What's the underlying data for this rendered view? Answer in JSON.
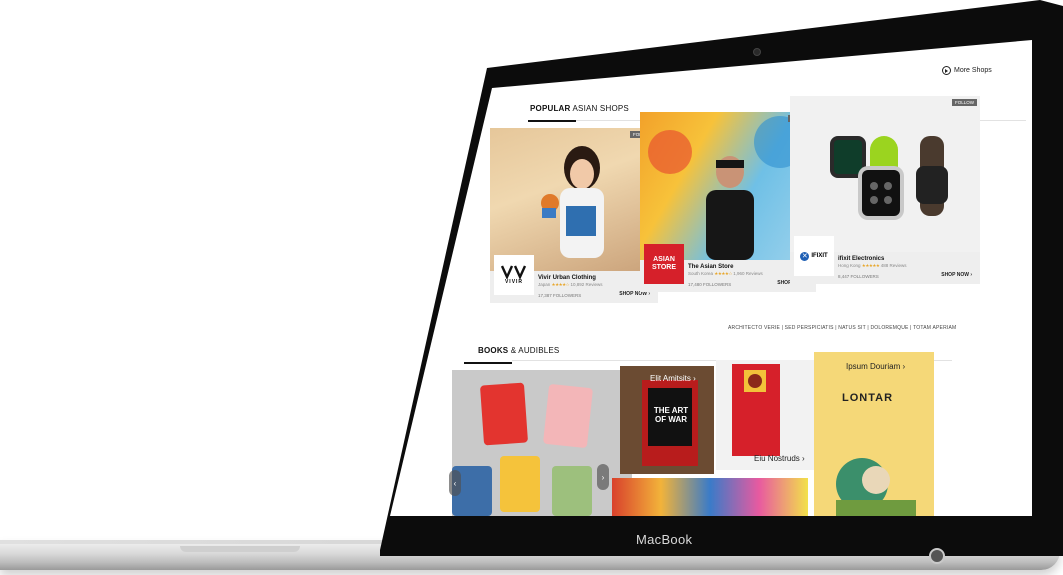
{
  "device": {
    "brand": "MacBook"
  },
  "header": {
    "more_shops": "More Shops"
  },
  "popular": {
    "title_bold": "POPULAR",
    "title_rest": " ASIAN SHOPS",
    "shops": [
      {
        "name": "Vivir Urban Clothing",
        "location": "Japan",
        "stars": "★★★★☆",
        "reviews": "10,892 Reviews",
        "followers": "17,387 FOLLOWERS",
        "cta": "SHOP NOW",
        "follow": "FOLLOW",
        "logo_text": "VIVIR"
      },
      {
        "name": "The Asian Store",
        "location": "South Korea",
        "stars": "★★★★☆",
        "reviews": "1,960 Reviews",
        "followers": "17,480 FOLLOWERS",
        "cta": "SHOP NOW",
        "follow": "FOLLOW",
        "logo_text": "ASIAN STORE"
      },
      {
        "name": "ifixit Electronics",
        "location": "Hong Kong",
        "stars": "★★★★★",
        "reviews": "488 Reviews",
        "followers": "8,447 FOLLOWERS",
        "cta": "SHOP NOW",
        "follow": "FOLLOW",
        "logo_text": "IFIXIT"
      }
    ]
  },
  "books": {
    "title_bold": "BOOKS",
    "title_rest": " & AUDIBLES",
    "categories": "ARCHITECTO VERIE  |  SED PERSPICIATIS  |  NATUS SIT  |  DOLOREMQUE  |  TOTAM APERIAM",
    "items": [
      {
        "title": "Elit Amitsits ›"
      },
      {
        "title": "Eiu Nostruds ›"
      },
      {
        "title": "Ipsum Douriam ›"
      }
    ],
    "lontar": "LONTAR",
    "art_of_war": "THE ART OF WAR"
  },
  "colors": {
    "accent": "#e8a72c",
    "dark": "#0c0c0c",
    "red": "#d6202a"
  }
}
